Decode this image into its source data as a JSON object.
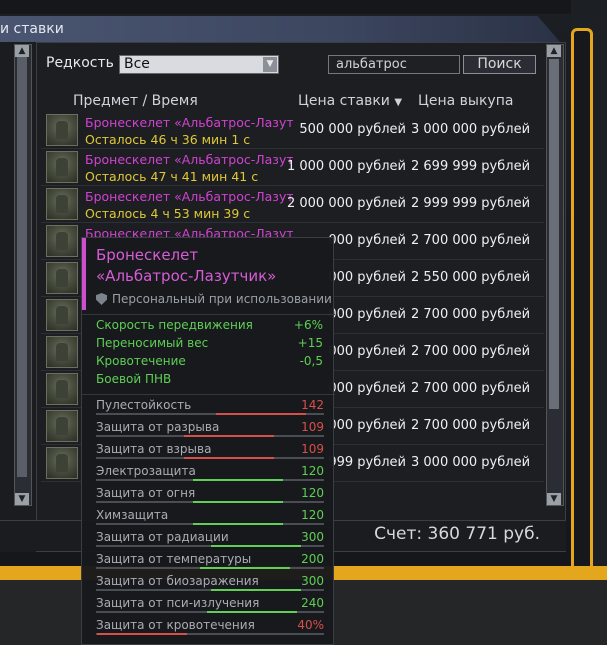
{
  "window": {
    "title": "и ставки"
  },
  "filters": {
    "rarity_label": "Редкость",
    "rarity_value": "Все",
    "search_value": "альбатрос",
    "search_button": "Поиск"
  },
  "table": {
    "headers": {
      "item_time": "Предмет   /   Время",
      "bid_price": "Цена ставки",
      "sort_indicator": "▼",
      "buyout_price": "Цена выкупа"
    },
    "rows": [
      {
        "name": "Бронескелет «Альбатрос-Лазутч...",
        "time": "Осталось 46 ч 36 мин 1 с",
        "bid": "500 000 рублей",
        "buyout": "3 000 000 рублей"
      },
      {
        "name": "Бронескелет «Альбатрос-Лазутч...",
        "time": "Осталось 47 ч 41 мин 41 с",
        "bid": "1 000 000 рублей",
        "buyout": "2 699 999 рублей"
      },
      {
        "name": "Бронескелет «Альбатрос-Лазутч...",
        "time": "Осталось 4 ч 53 мин 39 с",
        "bid": "2 000 000 рублей",
        "buyout": "2 999 999 рублей"
      },
      {
        "name": "Бронескелет «Альбатрос-Лазутч...",
        "time": "",
        "bid": "000 рублей",
        "buyout": "2 700 000 рублей"
      },
      {
        "name": "",
        "time": "",
        "bid": "000 рублей",
        "buyout": "2 550 000 рублей"
      },
      {
        "name": "",
        "time": "",
        "bid": "000 рублей",
        "buyout": "2 700 000 рублей"
      },
      {
        "name": "",
        "time": "",
        "bid": "000 рублей",
        "buyout": "2 700 000 рублей"
      },
      {
        "name": "",
        "time": "",
        "bid": "000 рублей",
        "buyout": "2 700 000 рублей"
      },
      {
        "name": "",
        "time": "",
        "bid": "000 рублей",
        "buyout": "2 700 000 рублей"
      },
      {
        "name": "",
        "time": "",
        "bid": "999 рублей",
        "buyout": "3 000 000 рублей"
      }
    ]
  },
  "balance": "Счет: 360 771 руб.",
  "tooltip": {
    "title_line1": "Бронескелет",
    "title_line2": "«Альбатрос-Лазутчик»",
    "personal": "Персональный при использовании",
    "stats": [
      {
        "label": "Скорость передвижения",
        "value": "+6%"
      },
      {
        "label": "Переносимый вес",
        "value": "+15"
      },
      {
        "label": "Кровотечение",
        "value": "-0,5"
      },
      {
        "label": "Боевой ПНВ",
        "value": ""
      }
    ],
    "protections": [
      {
        "label": "Пулестойкость",
        "value": "142",
        "level": 0.92,
        "color": "#d6504a"
      },
      {
        "label": "Защита от разрыва",
        "value": "109",
        "level": 0.78,
        "color": "#d6504a"
      },
      {
        "label": "Защита от взрыва",
        "value": "109",
        "level": 0.78,
        "color": "#d6504a"
      },
      {
        "label": "Электрозащита",
        "value": "120",
        "level": 0.82,
        "color": "#5fcf55"
      },
      {
        "label": "Защита от огня",
        "value": "120",
        "level": 0.82,
        "color": "#5fcf55"
      },
      {
        "label": "Химзащита",
        "value": "120",
        "level": 0.82,
        "color": "#5fcf55"
      },
      {
        "label": "Защита от радиации",
        "value": "300",
        "level": 0.9,
        "color": "#5fcf55"
      },
      {
        "label": "Защита от температуры",
        "value": "200",
        "level": 0.85,
        "color": "#5fcf55"
      },
      {
        "label": "Защита от биозаражения",
        "value": "300",
        "level": 0.9,
        "color": "#5fcf55"
      },
      {
        "label": "Защита от пси-излучения",
        "value": "240",
        "level": 0.88,
        "color": "#5fcf55"
      },
      {
        "label": "Защита от кровотечения",
        "value": "40%",
        "level": 0.4,
        "color": "#d6504a"
      }
    ]
  }
}
